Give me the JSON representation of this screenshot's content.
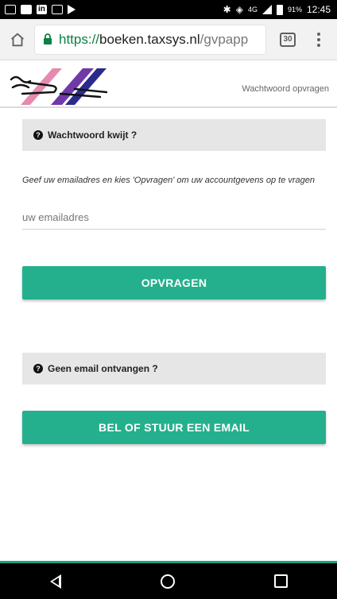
{
  "status_bar": {
    "battery": "91%",
    "time": "12:45",
    "network": "4G"
  },
  "browser": {
    "url_scheme": "https://",
    "url_host": "boeken.taxsys.nl",
    "url_path": "/gvpapp",
    "tab_count": "30"
  },
  "header": {
    "link_label": "Wachtwoord opvragen"
  },
  "forgot_section": {
    "title": "Wachtwoord kwijt ?",
    "instruction": "Geef uw emailadres en kies 'Opvragen' om uw accountgevens op te vragen",
    "email_placeholder": "uw emailadres",
    "email_value": "",
    "submit_label": "OPVRAGEN"
  },
  "no_email_section": {
    "title": "Geen email ontvangen ?",
    "contact_label": "BEL OF STUUR EEN EMAIL"
  },
  "colors": {
    "accent": "#24b08c",
    "panel": "#e6e6e6"
  }
}
